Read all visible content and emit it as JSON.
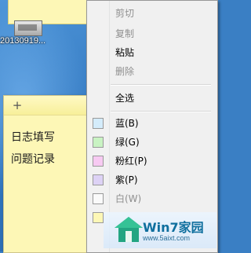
{
  "desktop": {
    "file_label": "20130919..."
  },
  "note": {
    "add_glyph": "+",
    "lines": [
      "日志填写",
      "问题记录"
    ]
  },
  "context_menu": {
    "edit_items": [
      {
        "label": "剪切",
        "disabled": true
      },
      {
        "label": "复制",
        "disabled": true
      },
      {
        "label": "粘贴",
        "disabled": false
      },
      {
        "label": "删除",
        "disabled": true
      }
    ],
    "select_all": "全选",
    "colors": [
      {
        "label": "蓝(B)",
        "swatch": "#d4ecfb"
      },
      {
        "label": "绿(G)",
        "swatch": "#c9f3c3"
      },
      {
        "label": "粉红(P)",
        "swatch": "#f7caf2"
      },
      {
        "label": "紫(P)",
        "swatch": "#ddd2f5"
      },
      {
        "label": "白(W)",
        "swatch": "#fafafa"
      },
      {
        "label": "",
        "swatch": "#fdf7b6"
      }
    ]
  },
  "watermark": {
    "brand": "Win7家园",
    "url": "www.5aixt.com"
  }
}
